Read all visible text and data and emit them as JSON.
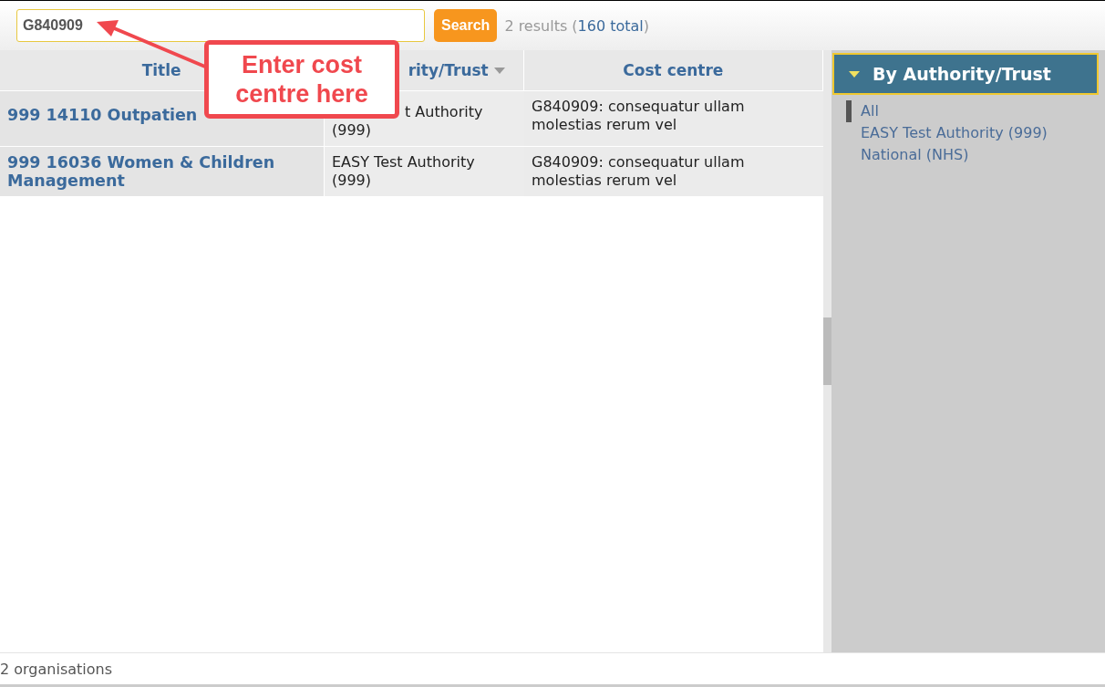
{
  "search": {
    "value": "G840909",
    "button": "Search",
    "results": "2 results (",
    "total": "160 total",
    "close": ")"
  },
  "table": {
    "columns": [
      {
        "label": "Title",
        "sort": false
      },
      {
        "label": "rity/Trust",
        "sort": true
      },
      {
        "label": "Cost centre",
        "sort": false
      }
    ],
    "rows": [
      {
        "title": "999 14110 Outpatien",
        "authority": "t Authority (999)",
        "indent": true,
        "cost_centre": "G840909: consequatur ullam molestias rerum vel"
      },
      {
        "title": "999 16036 Women & Children Management",
        "authority": "EASY Test Authority (999)",
        "indent": false,
        "cost_centre": "G840909: consequatur ullam molestias rerum vel"
      }
    ]
  },
  "callout": {
    "text": "Enter cost centre here"
  },
  "facet": {
    "title": "By Authority/Trust",
    "expanded": true,
    "items": [
      {
        "label": "All",
        "selected": true
      },
      {
        "label": "EASY Test Authority (999)",
        "selected": false
      },
      {
        "label": "National (NHS)",
        "selected": false
      }
    ]
  },
  "status_bar": "2 organisations"
}
